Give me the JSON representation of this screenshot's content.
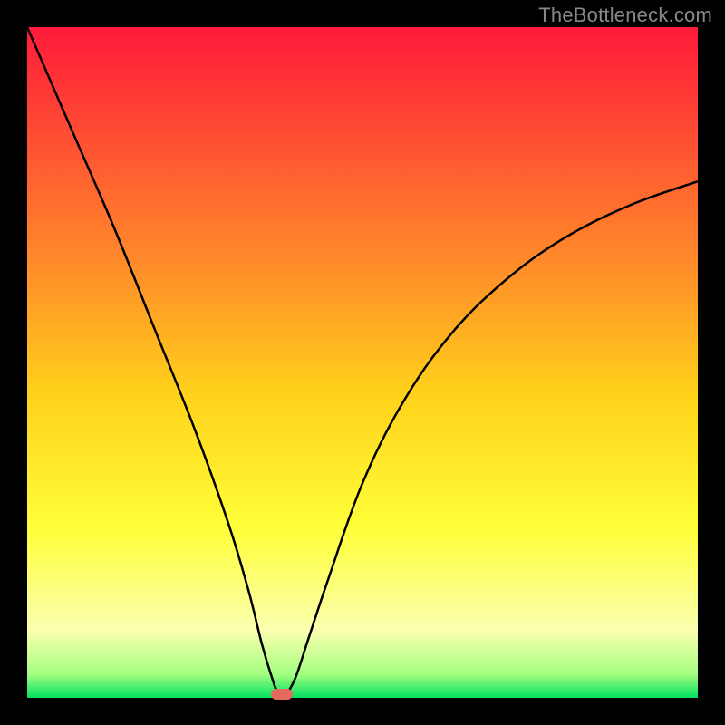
{
  "watermark": {
    "text": "TheBottleneck.com"
  },
  "colors": {
    "frame": "#000000",
    "watermark_text": "#888888",
    "gradient_stops": [
      {
        "offset": 0.0,
        "color": "#ff1a3a"
      },
      {
        "offset": 0.35,
        "color": "#ff8a2a"
      },
      {
        "offset": 0.55,
        "color": "#ffd21a"
      },
      {
        "offset": 0.75,
        "color": "#ffff3a"
      },
      {
        "offset": 0.9,
        "color": "#faffb0"
      },
      {
        "offset": 0.965,
        "color": "#a4ff80"
      },
      {
        "offset": 1.0,
        "color": "#00e060"
      }
    ],
    "curve": "#000000",
    "marker": "#e46a5e"
  },
  "chart_data": {
    "type": "line",
    "title": "",
    "xlabel": "",
    "ylabel": "",
    "xlim": [
      0,
      100
    ],
    "ylim": [
      0,
      100
    ],
    "grid": false,
    "legend": false,
    "annotations": [],
    "curve_points": [
      {
        "x": 0,
        "y": 100
      },
      {
        "x": 6.5,
        "y": 85
      },
      {
        "x": 13,
        "y": 70
      },
      {
        "x": 19,
        "y": 55
      },
      {
        "x": 25,
        "y": 40
      },
      {
        "x": 30,
        "y": 26
      },
      {
        "x": 33,
        "y": 16
      },
      {
        "x": 35,
        "y": 8
      },
      {
        "x": 36.5,
        "y": 3
      },
      {
        "x": 37.5,
        "y": 0.5
      },
      {
        "x": 38.5,
        "y": 0.5
      },
      {
        "x": 40,
        "y": 3
      },
      {
        "x": 42,
        "y": 9
      },
      {
        "x": 45,
        "y": 18
      },
      {
        "x": 50,
        "y": 32
      },
      {
        "x": 56,
        "y": 44
      },
      {
        "x": 63,
        "y": 54
      },
      {
        "x": 71,
        "y": 62
      },
      {
        "x": 80,
        "y": 68.5
      },
      {
        "x": 90,
        "y": 73.5
      },
      {
        "x": 100,
        "y": 77
      }
    ],
    "marker": {
      "x": 38,
      "y": 0.5
    }
  }
}
